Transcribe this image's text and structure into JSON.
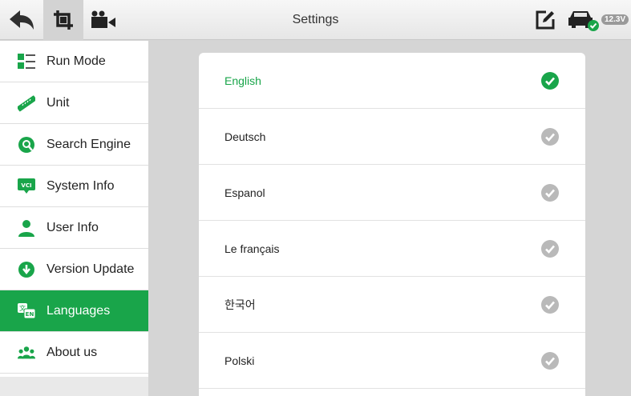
{
  "topbar": {
    "title": "Settings",
    "voltage": "12.3V",
    "icons": [
      "back-arrow-icon",
      "screenshot-crop-icon",
      "video-record-icon",
      "edit-icon",
      "vci-car-connected-icon"
    ]
  },
  "sidebar": {
    "items": [
      {
        "label": "Run Mode",
        "icon": "run-mode-icon"
      },
      {
        "label": "Unit",
        "icon": "ruler-icon"
      },
      {
        "label": "Search Engine",
        "icon": "search-engine-icon"
      },
      {
        "label": "System Info",
        "icon": "vci-icon"
      },
      {
        "label": "User Info",
        "icon": "user-icon"
      },
      {
        "label": "Version Update",
        "icon": "download-icon"
      },
      {
        "label": "Languages",
        "icon": "languages-icon",
        "active": true
      },
      {
        "label": "About us",
        "icon": "group-icon"
      }
    ]
  },
  "languages": [
    {
      "label": "English",
      "selected": true
    },
    {
      "label": "Deutsch",
      "selected": false
    },
    {
      "label": "Espanol",
      "selected": false
    },
    {
      "label": "Le français",
      "selected": false
    },
    {
      "label": "한국어",
      "selected": false
    },
    {
      "label": "Polski",
      "selected": false
    }
  ],
  "colors": {
    "accent": "#19a54a",
    "unselected_check": "#b9b9b9",
    "background": "#d5d5d5"
  }
}
